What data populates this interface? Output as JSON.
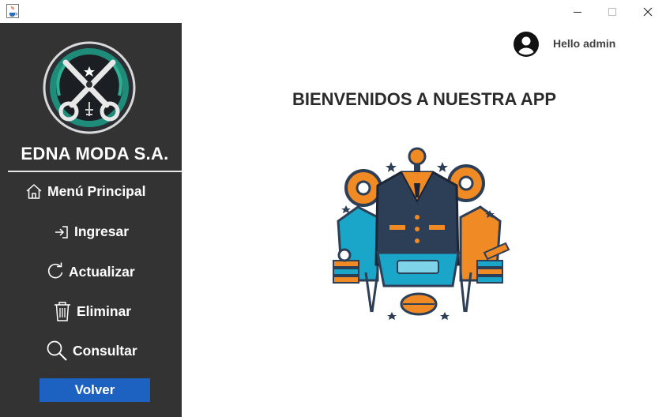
{
  "window": {
    "icons": {
      "app": "java-cup-icon",
      "minimize": "minimize-icon",
      "maximize": "maximize-icon",
      "close": "close-icon"
    }
  },
  "sidebar": {
    "brand": "EDNA MODA S.A.",
    "logo_icon": "scissors-emblem-logo",
    "items": [
      {
        "label": "Menú Principal",
        "icon": "home-icon"
      },
      {
        "label": "Ingresar",
        "icon": "login-icon"
      },
      {
        "label": "Actualizar",
        "icon": "refresh-icon"
      },
      {
        "label": "Eliminar",
        "icon": "trash-icon"
      },
      {
        "label": "Consultar",
        "icon": "search-icon"
      }
    ],
    "volver_label": "Volver"
  },
  "header": {
    "greeting": "Hello admin",
    "user_icon": "user-circle-icon"
  },
  "main": {
    "title": "BIENVENIDOS A NUESTRA APP",
    "illustration": "tailor-clothing-illustration"
  },
  "colors": {
    "sidebar_bg": "#333333",
    "volver_bg": "#1e62c1",
    "text_light": "#ffffff",
    "accent_orange": "#f08a24",
    "accent_teal": "#1aa6c8",
    "navy": "#2d3e57"
  }
}
